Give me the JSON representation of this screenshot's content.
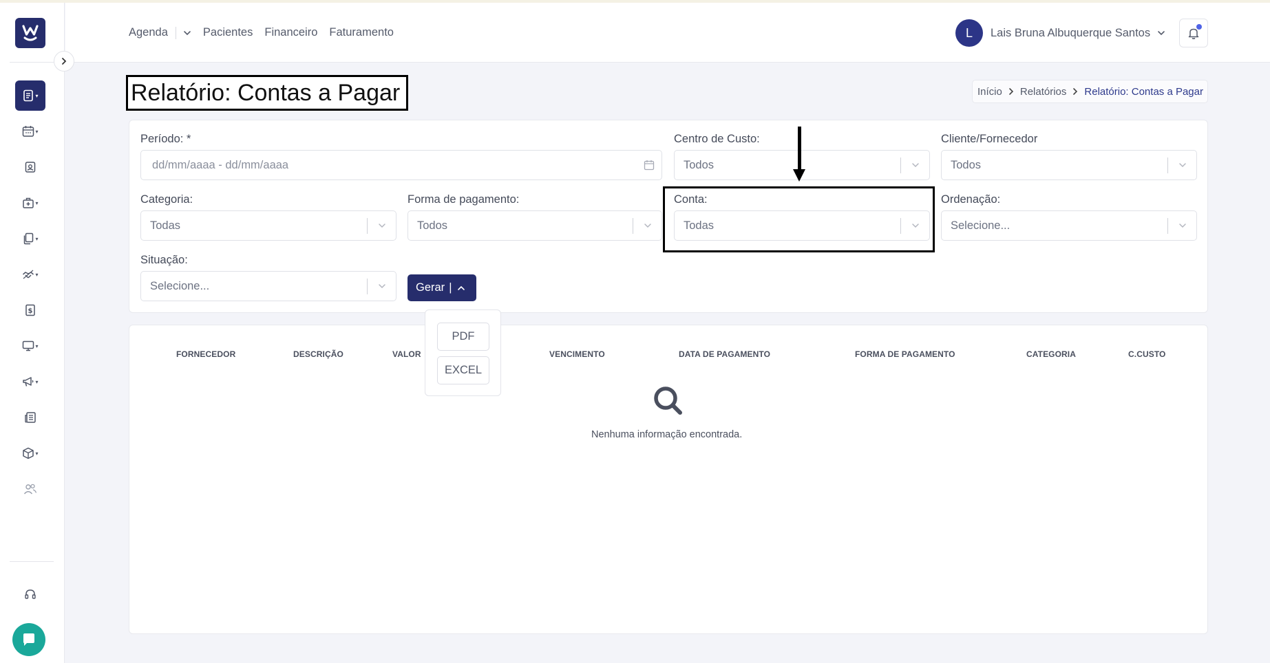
{
  "header": {
    "menu": [
      "Agenda",
      "Pacientes",
      "Financeiro",
      "Faturamento"
    ],
    "user": {
      "initial": "L",
      "name": "Lais Bruna Albuquerque Santos"
    }
  },
  "page": {
    "title": "Relatório: Contas a Pagar"
  },
  "breadcrumb": {
    "items": [
      "Início",
      "Relatórios"
    ],
    "current": "Relatório: Contas a Pagar"
  },
  "filters": {
    "periodo": {
      "label": "Período: *",
      "placeholder": "dd/mm/aaaa - dd/mm/aaaa"
    },
    "centro_custo": {
      "label": "Centro de Custo:",
      "value": "Todos"
    },
    "cliente_fornecedor": {
      "label": "Cliente/Fornecedor",
      "value": "Todos"
    },
    "categoria": {
      "label": "Categoria:",
      "value": "Todas"
    },
    "forma_pagamento": {
      "label": "Forma de pagamento:",
      "value": "Todos"
    },
    "conta": {
      "label": "Conta:",
      "value": "Todas"
    },
    "ordenacao": {
      "label": "Ordenação:",
      "value": "Selecione..."
    },
    "situacao": {
      "label": "Situação:",
      "value": "Selecione..."
    }
  },
  "actions": {
    "gerar_label": "Gerar",
    "gerar_separator": "|",
    "export_options": [
      "PDF",
      "EXCEL"
    ]
  },
  "table": {
    "columns": [
      "FORNECEDOR",
      "DESCRIÇÃO",
      "VALOR",
      "VENCIMENTO",
      "DATA DE PAGAMENTO",
      "FORMA DE PAGAMENTO",
      "CATEGORIA",
      "C.CUSTO"
    ],
    "empty_message": "Nenhuma informação encontrada."
  },
  "colors": {
    "primary": "#262d6c",
    "chat": "#1aa89a",
    "notification_dot": "#4f63e6"
  },
  "icons": {
    "sidebar": [
      "reports-icon",
      "calendar-icon",
      "patient-badge-icon",
      "clinic-icon",
      "documents-icon",
      "handshake-icon",
      "billing-icon",
      "monitor-icon",
      "megaphone-icon",
      "newspaper-icon",
      "package-icon",
      "users-icon",
      "headset-icon",
      "chat-icon"
    ]
  }
}
